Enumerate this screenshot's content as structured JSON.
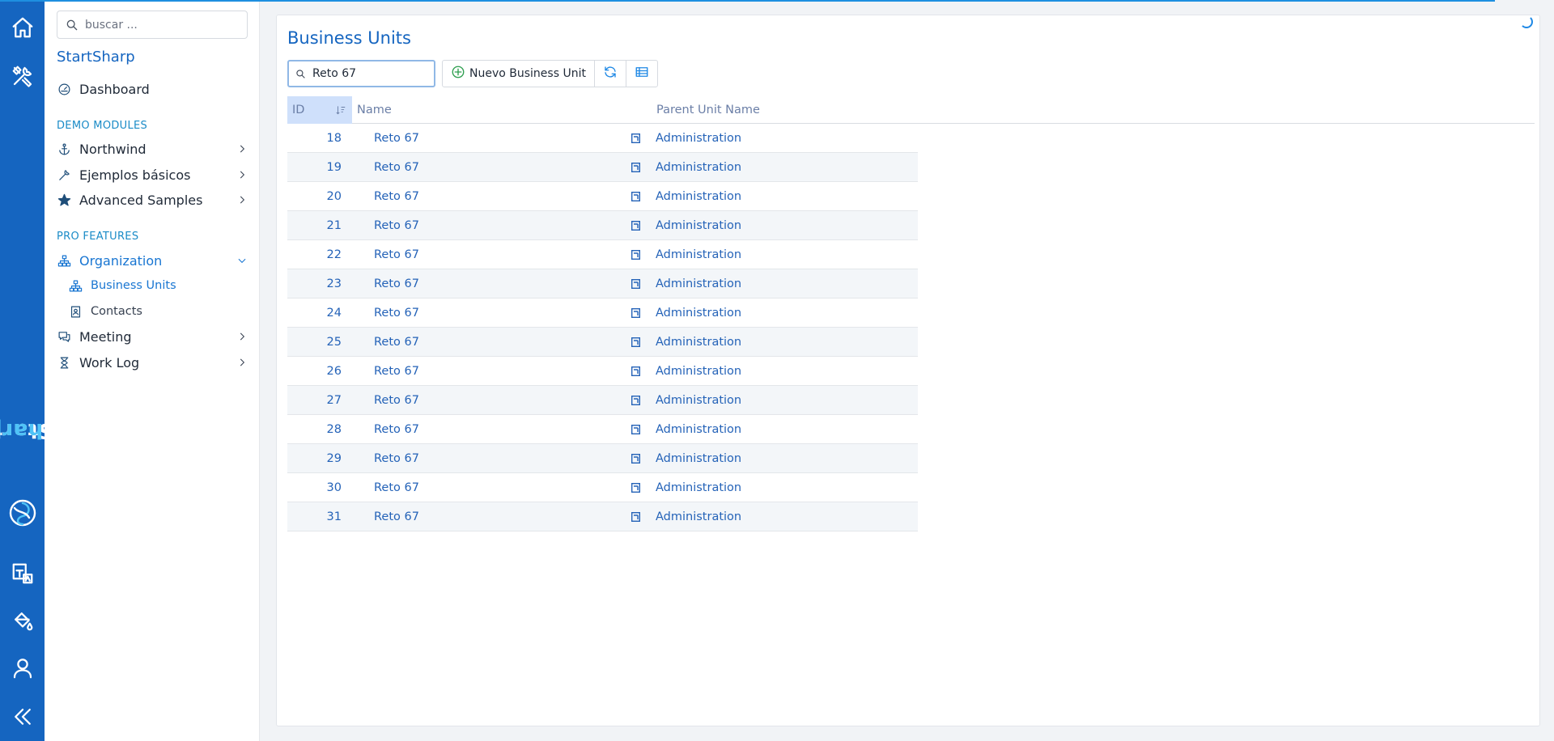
{
  "sidebar": {
    "search_placeholder": "buscar ...",
    "app_title": "StartSharp",
    "dashboard": "Dashboard",
    "section_demo": "DEMO MODULES",
    "northwind": "Northwind",
    "ejemplos": "Ejemplos básicos",
    "advanced": "Advanced Samples",
    "section_pro": "PRO FEATURES",
    "organization": "Organization",
    "business_units": "Business Units",
    "contacts": "Contacts",
    "meeting": "Meeting",
    "work_log": "Work Log"
  },
  "rail": {
    "brand_start": "Start",
    "brand_sharp": "Sharp"
  },
  "page": {
    "title": "Business Units",
    "quick_search_value": "Reto 67",
    "new_button": "Nuevo Business Unit"
  },
  "grid": {
    "columns": [
      "ID",
      "Name",
      "Parent Unit Name"
    ],
    "rows": [
      {
        "id": "18",
        "name": "Reto 67",
        "parent": "Administration"
      },
      {
        "id": "19",
        "name": "Reto 67",
        "parent": "Administration"
      },
      {
        "id": "20",
        "name": "Reto 67",
        "parent": "Administration"
      },
      {
        "id": "21",
        "name": "Reto 67",
        "parent": "Administration"
      },
      {
        "id": "22",
        "name": "Reto 67",
        "parent": "Administration"
      },
      {
        "id": "23",
        "name": "Reto 67",
        "parent": "Administration"
      },
      {
        "id": "24",
        "name": "Reto 67",
        "parent": "Administration"
      },
      {
        "id": "25",
        "name": "Reto 67",
        "parent": "Administration"
      },
      {
        "id": "26",
        "name": "Reto 67",
        "parent": "Administration"
      },
      {
        "id": "27",
        "name": "Reto 67",
        "parent": "Administration"
      },
      {
        "id": "28",
        "name": "Reto 67",
        "parent": "Administration"
      },
      {
        "id": "29",
        "name": "Reto 67",
        "parent": "Administration"
      },
      {
        "id": "30",
        "name": "Reto 67",
        "parent": "Administration"
      },
      {
        "id": "31",
        "name": "Reto 67",
        "parent": "Administration"
      }
    ]
  },
  "colors": {
    "rail": "#1565c0",
    "accent": "#1976d2",
    "section": "#1a8bc7",
    "link": "#2563b8"
  }
}
